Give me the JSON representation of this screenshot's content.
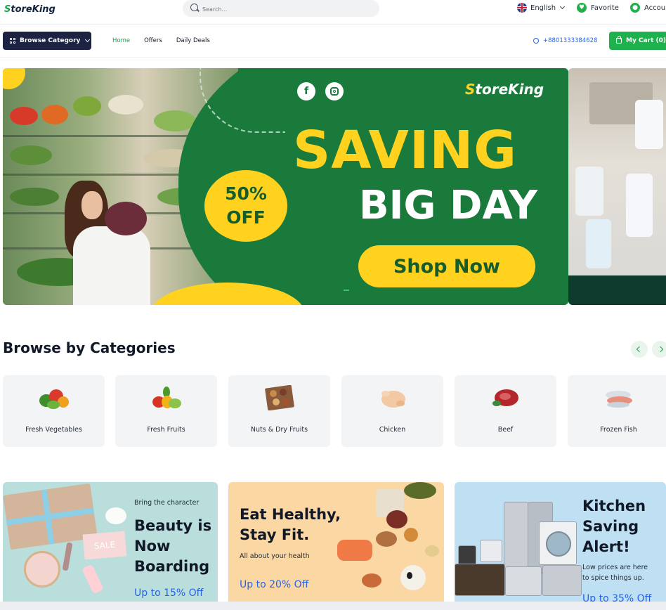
{
  "header": {
    "logo": "StoreKing",
    "search_placeholder": "Search...",
    "language": "English",
    "favorite": "Favorite",
    "account": "Account"
  },
  "nav": {
    "browse_label": "Browse Category",
    "links": [
      "Home",
      "Offers",
      "Daily Deals"
    ],
    "phone": "+8801333384628",
    "cart_label": "My Cart (0)"
  },
  "hero": {
    "brand": "StoreKing",
    "badge_line1": "50%",
    "badge_line2": "OFF",
    "headline1": "SAVING",
    "headline2": "BIG DAY",
    "cta": "Shop Now"
  },
  "categories": {
    "title": "Browse by Categories",
    "items": [
      {
        "label": "Fresh Vegetables",
        "icon": "vegetables-icon"
      },
      {
        "label": "Fresh Fruits",
        "icon": "fruits-icon"
      },
      {
        "label": "Nuts & Dry Fruits",
        "icon": "nuts-icon"
      },
      {
        "label": "Chicken",
        "icon": "chicken-icon"
      },
      {
        "label": "Beef",
        "icon": "beef-icon"
      },
      {
        "label": "Frozen Fish",
        "icon": "fish-icon"
      }
    ]
  },
  "promos": [
    {
      "small": "Bring the character",
      "title_lines": [
        "Beauty is",
        "Now",
        "Boarding"
      ],
      "offer": "Up to 15% Off"
    },
    {
      "small": "All about your health",
      "title_lines": [
        "Eat Healthy,",
        "Stay Fit."
      ],
      "offer": "Up to 20% Off"
    },
    {
      "small_lines": [
        "Low prices are here",
        "to spice things up."
      ],
      "title_lines": [
        "Kitchen",
        "Saving",
        "Alert!"
      ],
      "offer": "Up to 35% Off"
    }
  ],
  "colors": {
    "brand_green": "#1fb14e",
    "hero_green": "#1a7a3b",
    "accent_yellow": "#ffd21f",
    "navy": "#1c2242"
  }
}
